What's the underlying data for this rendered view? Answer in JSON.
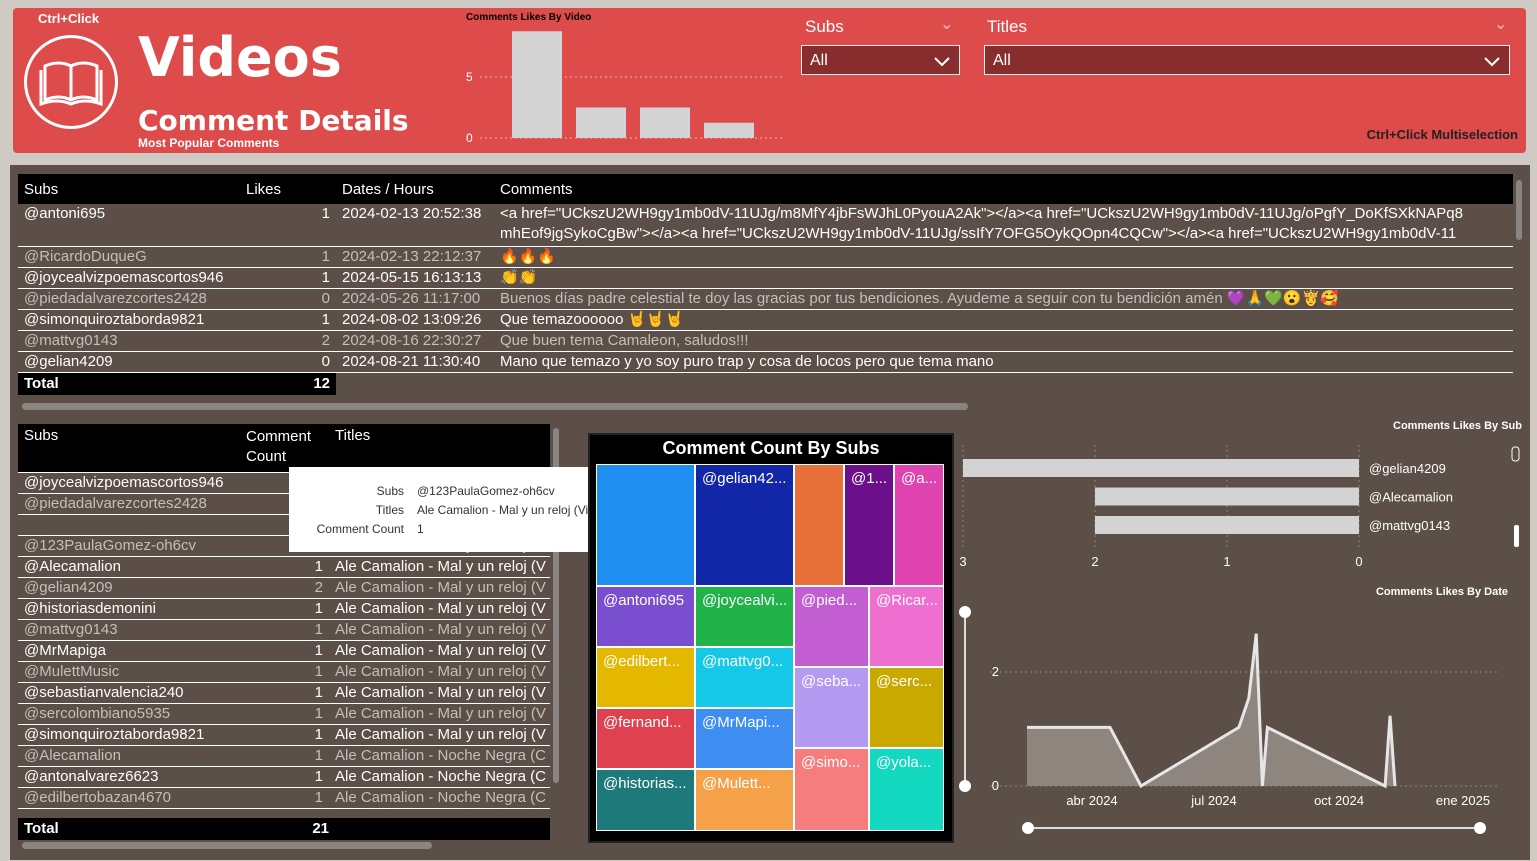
{
  "header": {
    "ctrl_click": "Ctrl+Click",
    "title": "Videos",
    "subtitle": "Comment Details",
    "caption": "Most Popular Comments",
    "multiselect_hint": "Ctrl+Click Multiselection",
    "accent_color": "#dd4b4b",
    "icon": "book-icon"
  },
  "slicers": {
    "subs": {
      "label": "Subs",
      "value": "All"
    },
    "titles": {
      "label": "Titles",
      "value": "All"
    }
  },
  "comments_table": {
    "columns": [
      "Subs",
      "Likes",
      "Dates / Hours",
      "Comments"
    ],
    "rows": [
      {
        "sub": "@antoni695",
        "likes": "1",
        "date": "2024-02-13 20:52:38",
        "comment": "<a href=\"UCkszU2WH9gy1mb0dV-11UJg/m8MfY4jbFsWJhL0PyouA2Ak\"></a><a href=\"UCkszU2WH9gy1mb0dV-11UJg/oPgfY_DoKfSXkNAPq8",
        "comment2": "mhEof9jgSykoCgBw\"></a><a href=\"UCkszU2WH9gy1mb0dV-11UJg/ssIfY7OFG5OykQOpn4CQCw\"></a><a href=\"UCkszU2WH9gy1mb0dV-11"
      },
      {
        "sub": "@RicardoDuqueG",
        "likes": "1",
        "date": "2024-02-13 22:12:37",
        "comment": "🔥🔥🔥"
      },
      {
        "sub": "@joycealvizpoemascortos946",
        "likes": "1",
        "date": "2024-05-15 16:13:13",
        "comment": "👏👏"
      },
      {
        "sub": "@piedadalvarezcortes2428",
        "likes": "0",
        "date": "2024-05-26 11:17:00",
        "comment": "Buenos días padre celestial te doy las gracias por tus bendiciones. Ayudeme a seguir con tu bendición amén 💜🙏💚😮👸🥰"
      },
      {
        "sub": "@simonquiroztaborda9821",
        "likes": "1",
        "date": "2024-08-02 13:09:26",
        "comment": "Que temazoooooo 🤘🤘🤘"
      },
      {
        "sub": "@mattvg0143",
        "likes": "2",
        "date": "2024-08-16 22:30:27",
        "comment": "Que buen tema Camaleon, saludos!!!"
      },
      {
        "sub": "@gelian4209",
        "likes": "0",
        "date": "2024-08-21 11:30:40",
        "comment": "Mano que temazo y yo soy puro trap y cosa de locos pero que tema mano"
      }
    ],
    "total_label": "Total",
    "total_likes": "12"
  },
  "count_table": {
    "columns": [
      "Subs",
      "Comment Count",
      "Titles"
    ],
    "col2_line1": "Comment",
    "col2_line2": "Count",
    "rows": [
      {
        "sub": "@joycealvizpoemascortos946",
        "count": "",
        "title": ""
      },
      {
        "sub": "@piedadalvarezcortes2428",
        "count": "",
        "title": ""
      },
      {
        "sub": "",
        "count": "",
        "title": ""
      },
      {
        "sub": "@123PaulaGomez-oh6cv",
        "count": "",
        "title": "Ale Camalion - Mal y un reloj"
      },
      {
        "sub": "@Alecamalion",
        "count": "1",
        "title": "Ale Camalion - Mal y un reloj (V"
      },
      {
        "sub": "@gelian4209",
        "count": "2",
        "title": "Ale Camalion - Mal y un reloj (V"
      },
      {
        "sub": "@historiasdemonini",
        "count": "1",
        "title": "Ale Camalion - Mal y un reloj (V"
      },
      {
        "sub": "@mattvg0143",
        "count": "1",
        "title": "Ale Camalion - Mal y un reloj (V"
      },
      {
        "sub": "@MrMapiga",
        "count": "1",
        "title": "Ale Camalion - Mal y un reloj (V"
      },
      {
        "sub": "@MulettMusic",
        "count": "1",
        "title": "Ale Camalion - Mal y un reloj (V"
      },
      {
        "sub": "@sebastianvalencia240",
        "count": "1",
        "title": "Ale Camalion - Mal y un reloj (V"
      },
      {
        "sub": "@sercolombiano5935",
        "count": "1",
        "title": "Ale Camalion - Mal y un reloj (V"
      },
      {
        "sub": "@simonquiroztaborda9821",
        "count": "1",
        "title": "Ale Camalion - Mal y un reloj (V"
      },
      {
        "sub": "@Alecamalion",
        "count": "1",
        "title": "Ale Camalion - Noche Negra (C"
      },
      {
        "sub": "@antonalvarez6623",
        "count": "1",
        "title": "Ale Camalion - Noche Negra (C"
      },
      {
        "sub": "@edilbertobazan4670",
        "count": "1",
        "title": "Ale Camalion - Noche Negra (C"
      }
    ],
    "total_label": "Total",
    "total_count": "21"
  },
  "tooltip": {
    "subs_key": "Subs",
    "subs_val": "@123PaulaGomez-oh6cv",
    "titles_key": "Titles",
    "titles_val": "Ale Camalion - Mal y un reloj (Video Oficial)",
    "count_key": "Comment Count",
    "count_val": "1"
  },
  "treemap": {
    "title": "Comment Count By Subs",
    "tiles": [
      {
        "label": "",
        "color": "#1f8ef1"
      },
      {
        "label": "@gelian42...",
        "color": "#1226a8"
      },
      {
        "label": "",
        "color": "#e8703a"
      },
      {
        "label": "@1...",
        "color": "#6b0f8a"
      },
      {
        "label": "@a...",
        "color": "#e043b0"
      },
      {
        "label": "@antoni695",
        "color": "#7a4fcf"
      },
      {
        "label": "@joycealvi...",
        "color": "#21b24a"
      },
      {
        "label": "@pied...",
        "color": "#c25ed2"
      },
      {
        "label": "@Ricar...",
        "color": "#ee6fd0"
      },
      {
        "label": "@edilbert...",
        "color": "#e5b800"
      },
      {
        "label": "@mattvg0...",
        "color": "#16c8e8"
      },
      {
        "label": "@seba...",
        "color": "#b49af0"
      },
      {
        "label": "@serc...",
        "color": "#c9a800"
      },
      {
        "label": "@fernand...",
        "color": "#e0414f"
      },
      {
        "label": "@MrMapi...",
        "color": "#3d8ef0"
      },
      {
        "label": "@simo...",
        "color": "#f57d7d"
      },
      {
        "label": "@yola...",
        "color": "#12d9c0"
      },
      {
        "label": "@historias...",
        "color": "#1e7a7a"
      },
      {
        "label": "@Mulett...",
        "color": "#f5a14a"
      }
    ]
  },
  "chart_data": [
    {
      "type": "bar",
      "title": "Comments Likes By Video",
      "categories": [
        "1",
        "2",
        "3",
        "4"
      ],
      "values": [
        7,
        2,
        2,
        1
      ],
      "yticks": [
        "5",
        "0"
      ],
      "ylim": [
        0,
        8
      ]
    },
    {
      "type": "bar",
      "title": "Comments Likes By Sub",
      "orientation": "horizontal",
      "categories": [
        "@gelian4209",
        "@Alecamalion",
        "@mattvg0143"
      ],
      "values": [
        3,
        2,
        2
      ],
      "xticks": [
        "3",
        "2",
        "1",
        "0"
      ],
      "xlim": [
        3,
        0
      ]
    },
    {
      "type": "area",
      "title": "Comments Likes By Date",
      "xticks": [
        "abr 2024",
        "jul 2024",
        "oct 2024",
        "ene 2025"
      ],
      "yticks": [
        "2",
        "0"
      ],
      "x": [
        "2024-02-13",
        "2024-04-20",
        "2024-05-15",
        "2024-08-02",
        "2024-08-10",
        "2024-08-16",
        "2024-08-21",
        "2024-08-25",
        "2024-11-28",
        "2024-12-02",
        "2024-12-06"
      ],
      "y": [
        1,
        1,
        0,
        1,
        1.5,
        2.6,
        0,
        1,
        0,
        1.2,
        0
      ],
      "ylim": [
        0,
        2.8
      ]
    }
  ]
}
